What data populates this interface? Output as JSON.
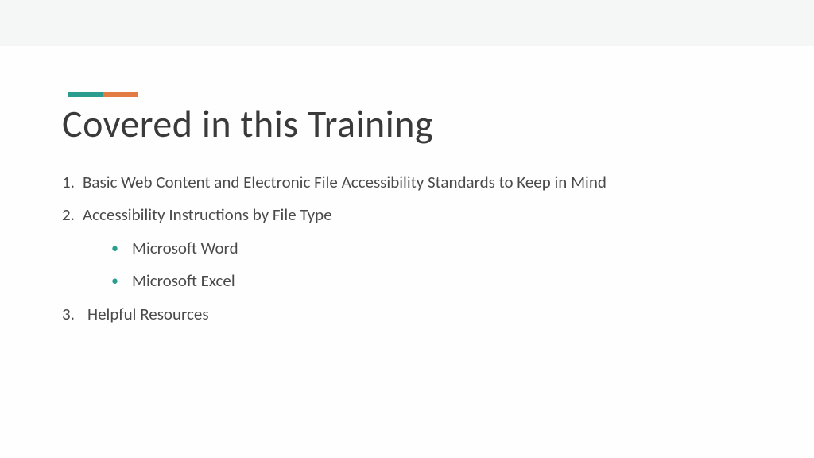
{
  "slide": {
    "title": "Covered in this Training",
    "items": [
      {
        "number": "1.",
        "text": "Basic Web Content and Electronic File Accessibility Standards to Keep in Mind"
      },
      {
        "number": "2.",
        "text": "Accessibility Instructions by File Type"
      },
      {
        "number": "3.",
        "text": "Helpful Resources"
      }
    ],
    "subitems": [
      "Microsoft Word",
      "Microsoft Excel"
    ]
  }
}
